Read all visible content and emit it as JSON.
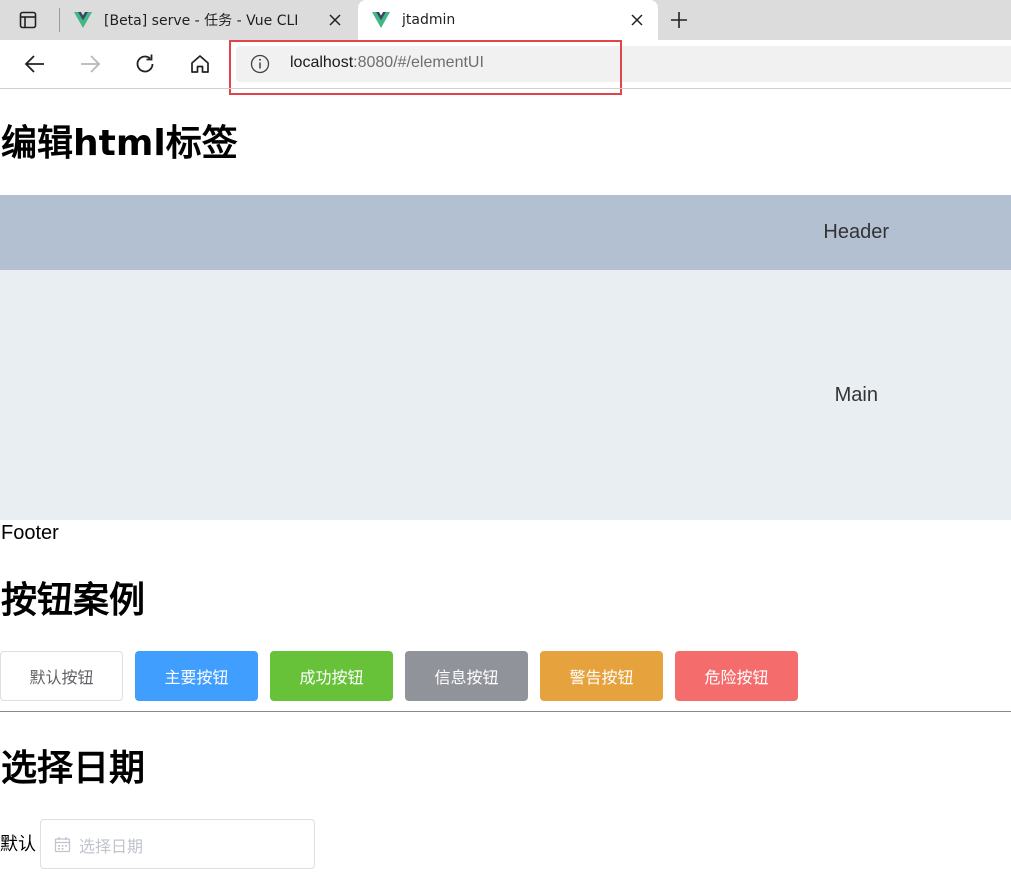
{
  "browser": {
    "tabs": [
      {
        "title": "[Beta] serve - 任务 - Vue CLI",
        "active": false
      },
      {
        "title": "jtadmin",
        "active": true
      }
    ],
    "address": {
      "host": "localhost",
      "path": ":8080/#/elementUI"
    },
    "highlight_color": "#e0454a"
  },
  "page": {
    "title_html": "编辑html标签",
    "header_text": "Header",
    "main_text": "Main",
    "footer_text": "Footer",
    "title_buttons": "按钮案例",
    "buttons": [
      {
        "label": "默认按钮",
        "type": "default",
        "color": "#ffffff"
      },
      {
        "label": "主要按钮",
        "type": "primary",
        "color": "#409eff"
      },
      {
        "label": "成功按钮",
        "type": "success",
        "color": "#67c23a"
      },
      {
        "label": "信息按钮",
        "type": "info",
        "color": "#909399"
      },
      {
        "label": "警告按钮",
        "type": "warning",
        "color": "#e6a23c"
      },
      {
        "label": "危险按钮",
        "type": "danger",
        "color": "#f56c6c"
      }
    ],
    "title_date": "选择日期",
    "date_label": "默认",
    "date_placeholder": "选择日期",
    "colors": {
      "header_bg": "#b3c0d1",
      "main_bg": "#e9eef3"
    }
  }
}
